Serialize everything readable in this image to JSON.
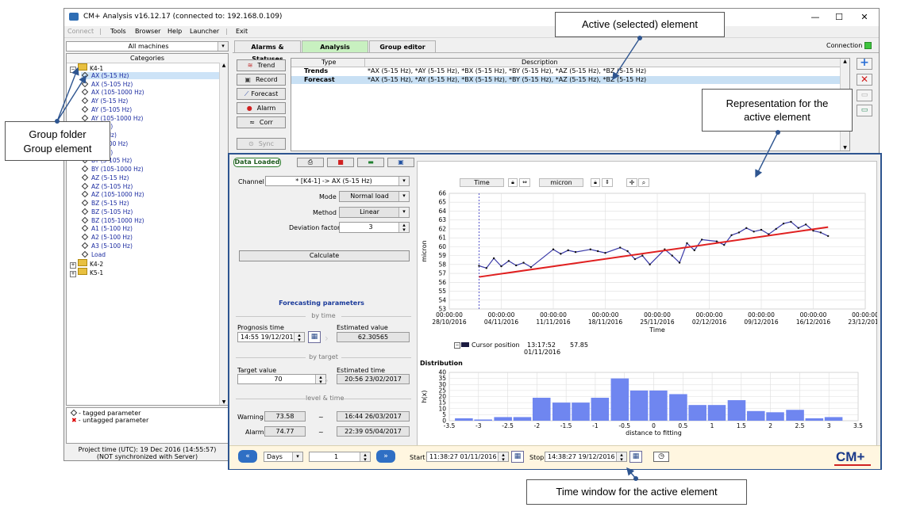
{
  "window": {
    "title": "CM+ Analysis v16.12.17 (connected to: 192.168.0.109)",
    "minimize": "—",
    "maximize": "☐",
    "close": "✕"
  },
  "menu": {
    "connect": "Connect",
    "tools": "Tools",
    "browser": "Browser",
    "help": "Help",
    "launcher": "Launcher",
    "exit": "Exit"
  },
  "machines": {
    "selected": "All machines"
  },
  "categories": {
    "header": "Categories",
    "root": "K4-1",
    "items": [
      "AX (5-15 Hz)",
      "AX (5-105 Hz)",
      "AX (105-1000 Hz)",
      "AY (5-15 Hz)",
      "AY (5-105 Hz)",
      "AY (105-1000 Hz)",
      "AY (5-15 Hz)",
      "AY (5-105 Hz)",
      "AY (105-1000 Hz)",
      "BY (5-15 Hz)",
      "BY (5-105 Hz)",
      "BY (105-1000 Hz)",
      "AZ (5-15 Hz)",
      "AZ (5-105 Hz)",
      "AZ (105-1000 Hz)",
      "BZ (5-15 Hz)",
      "BZ (5-105 Hz)",
      "BZ (105-1000 Hz)",
      "A1 (5-100 Hz)",
      "A2 (5-100 Hz)",
      "A3 (5-100 Hz)",
      "Load"
    ],
    "visible_fragments": [
      "AX (5-15 Hz)",
      "AX (5-105 Hz)",
      "AX (105-1000 Hz)",
      "AY (5-15 Hz)",
      "AY (5-105 Hz)",
      "AY (105-1000 Hz)",
      "-15 Hz)",
      "-105 Hz)",
      "05-1000 Hz)",
      "-15 Hz)",
      "BY (5-105 Hz)",
      "BY (105-1000 Hz)",
      "AZ (5-15 Hz)",
      "AZ (5-105 Hz)",
      "AZ (105-1000 Hz)",
      "BZ (5-15 Hz)",
      "BZ (5-105 Hz)",
      "BZ (105-1000 Hz)",
      "A1 (5-100 Hz)",
      "A2 (5-100 Hz)",
      "A3 (5-100 Hz)",
      "Load"
    ],
    "others": [
      "K4-2",
      "K5-1"
    ]
  },
  "legend": {
    "tagged": "- tagged parameter",
    "untagged": "- untagged parameter"
  },
  "status": {
    "project_time": "Project time (UTC): 19 Dec 2016 (14:55:57)",
    "sync": "(NOT synchronized with Server)"
  },
  "tabs": {
    "alarms": "Alarms & Statuses",
    "analysis": "Analysis",
    "group_editor": "Group editor"
  },
  "connection": {
    "label": "Connection",
    "color": "#3ec43e"
  },
  "left_buttons": {
    "trend": "Trend",
    "record": "Record",
    "forecast": "Forecast",
    "alarm": "Alarm",
    "corr": "Corr",
    "sync": "Sync"
  },
  "element_table": {
    "headers": [
      "Type",
      "Description"
    ],
    "rows": [
      {
        "type": "Trends",
        "desc": "*AX (5-15 Hz), *AY (5-15 Hz), *BX (5-15 Hz), *BY (5-15 Hz), *AZ (5-15 Hz), *BZ (5-15 Hz)"
      },
      {
        "type": "Forecast",
        "desc": "*AX (5-15 Hz), *AY (5-15 Hz), *BX (5-15 Hz), *BY (5-15 Hz), *AZ (5-15 Hz), *BZ (5-15 Hz)"
      }
    ]
  },
  "forecast": {
    "data_loaded": "Data Loaded",
    "channel_label": "Channel",
    "channel_value": "* [K4-1] -> AX (5-15 Hz)",
    "mode_label": "Mode",
    "mode_value": "Normal load",
    "method_label": "Method",
    "method_value": "Linear",
    "deviation_label": "Deviation factor",
    "deviation_value": "3",
    "calculate": "Calculate",
    "params_title": "Forecasting parameters",
    "by_time": "by time",
    "prognosis_label": "Prognosis time",
    "prognosis_value": "14:55 19/12/2016",
    "estimated_value_label": "Estimated value",
    "estimated_value": "62.30565",
    "by_target": "by target",
    "target_label": "Target value",
    "target_value": "70",
    "estimated_time_label": "Estimated time",
    "estimated_time": "20:56 23/02/2017",
    "level_time": "level & time",
    "warning_label": "Warning",
    "warning_value": "73.58",
    "warning_time": "16:44 26/03/2017",
    "alarm_label": "Alarm",
    "alarm_value": "74.77",
    "alarm_time": "22:39 05/04/2017",
    "tilde": "~"
  },
  "trend_header": {
    "time": "Time",
    "micron": "micron"
  },
  "cursor": {
    "label": "Cursor position",
    "time": "13:17:52",
    "date": "01/11/2016",
    "value": "57.85"
  },
  "bottom_bar": {
    "unit": "Days",
    "count": "1",
    "start_label": "Start",
    "start_value": "11:38:27 01/11/2016",
    "stop_label": "Stop",
    "stop_value": "14:38:27 19/12/2016",
    "logo": "CM+"
  },
  "callouts": {
    "active": "Active (selected) element",
    "representation_1": "Representation for the",
    "representation_2": "active element",
    "group_1": "Group folder",
    "group_2": "Group element",
    "window": "Time window for the active element"
  },
  "chart_data": [
    {
      "type": "line",
      "xlabel": "Time",
      "ylabel": "micron",
      "ylim": [
        53,
        66
      ],
      "yticks": [
        53,
        54,
        55,
        56,
        57,
        58,
        59,
        60,
        61,
        62,
        63,
        64,
        65,
        66
      ],
      "xticks": [
        {
          "time": "00:00:00",
          "date": "28/10/2016"
        },
        {
          "time": "00:00:00",
          "date": "04/11/2016"
        },
        {
          "time": "00:00:00",
          "date": "11/11/2016"
        },
        {
          "time": "00:00:00",
          "date": "18/11/2016"
        },
        {
          "time": "00:00:00",
          "date": "25/11/2016"
        },
        {
          "time": "00:00:00",
          "date": "02/12/2016"
        },
        {
          "time": "00:00:00",
          "date": "09/12/2016"
        },
        {
          "time": "00:00:00",
          "date": "16/12/2016"
        },
        {
          "time": "00:00:00",
          "date": "23/12/2016"
        }
      ],
      "x_start": "01/11/2016",
      "x_end": "19/12/2016",
      "grid": true,
      "fit_line": {
        "x": [
          "01/11/2016",
          "18/12/2016"
        ],
        "y": [
          56.6,
          62.2
        ],
        "color": "#e02020"
      },
      "series_color": "#3a3aa8",
      "samples": [
        {
          "x": "01/11/2016",
          "y": 57.85
        },
        {
          "x": "02/11/2016",
          "y": 57.6
        },
        {
          "x": "03/11/2016",
          "y": 58.7
        },
        {
          "x": "04/11/2016",
          "y": 57.8
        },
        {
          "x": "05/11/2016",
          "y": 58.4
        },
        {
          "x": "06/11/2016",
          "y": 57.9
        },
        {
          "x": "07/11/2016",
          "y": 58.2
        },
        {
          "x": "08/11/2016",
          "y": 57.7
        },
        {
          "x": "11/11/2016",
          "y": 59.7
        },
        {
          "x": "12/11/2016",
          "y": 59.2
        },
        {
          "x": "13/11/2016",
          "y": 59.6
        },
        {
          "x": "14/11/2016",
          "y": 59.4
        },
        {
          "x": "16/11/2016",
          "y": 59.7
        },
        {
          "x": "17/11/2016",
          "y": 59.5
        },
        {
          "x": "18/11/2016",
          "y": 59.3
        },
        {
          "x": "20/11/2016",
          "y": 59.9
        },
        {
          "x": "21/11/2016",
          "y": 59.5
        },
        {
          "x": "22/11/2016",
          "y": 58.6
        },
        {
          "x": "23/11/2016",
          "y": 59.0
        },
        {
          "x": "24/11/2016",
          "y": 58.0
        },
        {
          "x": "26/11/2016",
          "y": 59.7
        },
        {
          "x": "27/11/2016",
          "y": 59.0
        },
        {
          "x": "28/11/2016",
          "y": 58.2
        },
        {
          "x": "29/11/2016",
          "y": 60.4
        },
        {
          "x": "30/11/2016",
          "y": 59.6
        },
        {
          "x": "01/12/2016",
          "y": 60.8
        },
        {
          "x": "03/12/2016",
          "y": 60.6
        },
        {
          "x": "04/12/2016",
          "y": 60.2
        },
        {
          "x": "05/12/2016",
          "y": 61.3
        },
        {
          "x": "06/12/2016",
          "y": 61.6
        },
        {
          "x": "07/12/2016",
          "y": 62.1
        },
        {
          "x": "08/12/2016",
          "y": 61.7
        },
        {
          "x": "09/12/2016",
          "y": 61.9
        },
        {
          "x": "10/12/2016",
          "y": 61.4
        },
        {
          "x": "11/12/2016",
          "y": 62.0
        },
        {
          "x": "12/12/2016",
          "y": 62.6
        },
        {
          "x": "13/12/2016",
          "y": 62.8
        },
        {
          "x": "14/12/2016",
          "y": 62.1
        },
        {
          "x": "15/12/2016",
          "y": 62.5
        },
        {
          "x": "16/12/2016",
          "y": 61.8
        },
        {
          "x": "17/12/2016",
          "y": 61.6
        },
        {
          "x": "18/12/2016",
          "y": 61.2
        }
      ]
    },
    {
      "type": "bar",
      "title": "Distribution",
      "xlabel": "distance to fitting",
      "ylabel": "h(x)",
      "ylim": [
        0,
        40
      ],
      "yticks": [
        0,
        5,
        10,
        15,
        20,
        25,
        30,
        35,
        40
      ],
      "xlim": [
        -3.5,
        3.5
      ],
      "xticks": [
        "-3.5",
        "-3",
        "-2.5",
        "-2",
        "-1.5",
        "-1",
        "-0.5",
        "0",
        "0.5",
        "1",
        "1.5",
        "2",
        "2.5",
        "3",
        "3.5"
      ],
      "bar_centers": [
        -3.25,
        -2.92,
        -2.58,
        -2.25,
        -1.92,
        -1.58,
        -1.25,
        -0.92,
        -0.58,
        -0.25,
        0.08,
        0.42,
        0.75,
        1.08,
        1.42,
        1.75,
        2.08,
        2.42,
        2.75,
        3.08,
        3.42
      ],
      "values": [
        2,
        1,
        3,
        3,
        19,
        15,
        15,
        19,
        35,
        25,
        25,
        22,
        13,
        13,
        17,
        8,
        7,
        9,
        2,
        3,
        0
      ],
      "color": "#6f86f0",
      "grid": true
    }
  ]
}
